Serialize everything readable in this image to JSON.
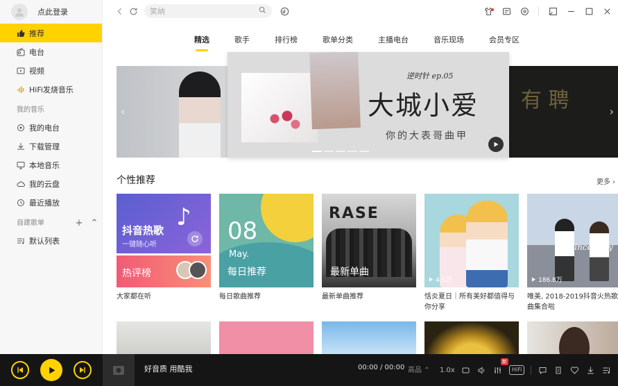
{
  "user": {
    "login_label": "点此登录"
  },
  "sidebar": {
    "main_items": [
      {
        "label": "推荐",
        "icon": "thumb-up-icon",
        "active": true
      },
      {
        "label": "电台",
        "icon": "radio-icon"
      },
      {
        "label": "视频",
        "icon": "video-icon"
      },
      {
        "label": "HiFi发烧音乐",
        "icon": "hifi-icon"
      }
    ],
    "my_music_title": "我的音乐",
    "my_music_items": [
      {
        "label": "我的电台",
        "icon": "radio-icon"
      },
      {
        "label": "下载管理",
        "icon": "download-icon"
      },
      {
        "label": "本地音乐",
        "icon": "monitor-icon"
      },
      {
        "label": "我的云盘",
        "icon": "cloud-icon"
      },
      {
        "label": "最近播放",
        "icon": "clock-icon"
      }
    ],
    "playlist_title": "自建歌单",
    "playlist_add": "+",
    "playlist_collapse": "⌃",
    "playlist_items": [
      {
        "label": "默认列表",
        "icon": "list-icon"
      }
    ]
  },
  "search": {
    "placeholder": "笑纳"
  },
  "tabs": [
    "精选",
    "歌手",
    "排行榜",
    "歌单分类",
    "主播电台",
    "音乐现场",
    "会员专区"
  ],
  "banner": {
    "series": "逆时针 ep.05",
    "title": "大城小爱",
    "subtitle": "你的大表哥曲甲",
    "right_text": "有 聘"
  },
  "section": {
    "title": "个性推荐",
    "more": "更多 ›"
  },
  "cards": [
    {
      "title": "大家都在听",
      "cover_main": "抖音热歌",
      "cover_sub": "一键随心听",
      "cover_bottom": "热评榜"
    },
    {
      "title": "每日歌曲推荐",
      "cover_day": "08",
      "cover_month": "May.",
      "cover_label": "每日推荐"
    },
    {
      "title": "最新单曲推荐",
      "cover_logo": "RASE",
      "cover_label": "最新单曲"
    },
    {
      "title": "恬炎夏日｜所有美好都值得与你分享",
      "plays": "4.5万"
    },
    {
      "title": "唯美, 2018-2019抖音火热歌曲集合啦",
      "plays": "186.8万",
      "cover_sign": "Since May"
    }
  ],
  "player": {
    "title": "好音质 用酷我",
    "time": "00:00 / 00:00",
    "quality": "高品 ⌃",
    "speed": "1.0x",
    "hifi": "HiFi",
    "new_badge": "新"
  },
  "colors": {
    "accent": "#ffd200",
    "player_bg": "#151515"
  }
}
